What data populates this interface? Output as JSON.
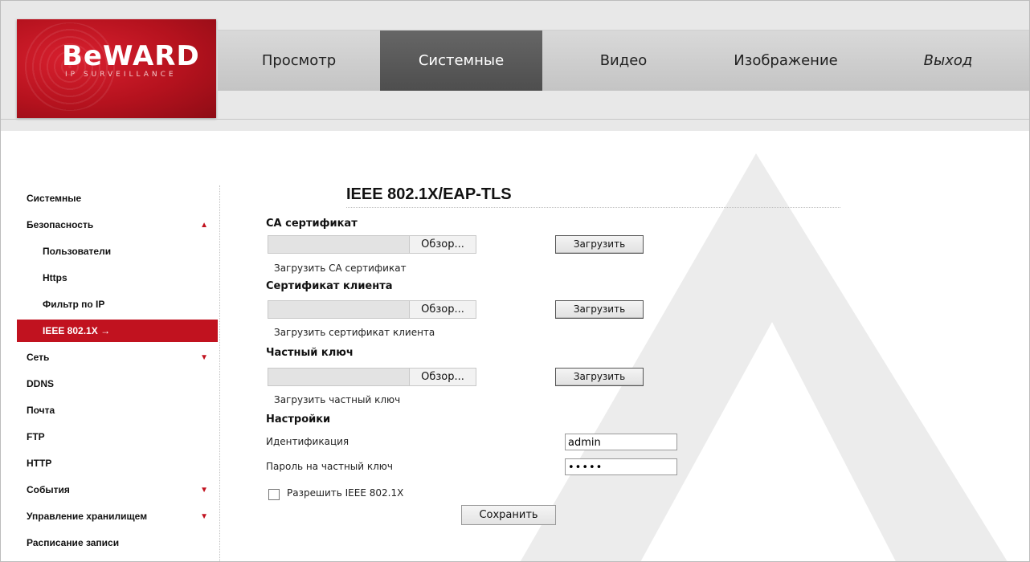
{
  "brand": {
    "name": "BeWARD",
    "tagline": "IP SURVEILLANCE",
    "accent_color": "#c1121f"
  },
  "nav": {
    "items": [
      {
        "label": "Просмотр"
      },
      {
        "label": "Системные"
      },
      {
        "label": "Видео"
      },
      {
        "label": "Изображение"
      },
      {
        "label": "Выход"
      }
    ],
    "active_index": 1
  },
  "sidebar": {
    "items": [
      {
        "label": "Системные"
      },
      {
        "label": "Безопасность",
        "expand_icon": "triangle-up-icon"
      },
      {
        "label": "Пользователи"
      },
      {
        "label": "Https"
      },
      {
        "label": "Фильтр по IP"
      },
      {
        "label": "IEEE 802.1X",
        "indicator": "→"
      },
      {
        "label": "Сеть",
        "expand_icon": "triangle-down-icon"
      },
      {
        "label": "DDNS"
      },
      {
        "label": "Почта"
      },
      {
        "label": "FTP"
      },
      {
        "label": "HTTP"
      },
      {
        "label": "События",
        "expand_icon": "triangle-down-icon"
      },
      {
        "label": "Управление хранилищем",
        "expand_icon": "triangle-down-icon"
      },
      {
        "label": "Расписание записи"
      }
    ],
    "active_index": 5
  },
  "main": {
    "title": "IEEE 802.1X/EAP-TLS",
    "ca": {
      "heading": "CA сертификат",
      "browse_label": "Обзор...",
      "upload_label": "Загрузить",
      "caption": "Загрузить CA сертификат"
    },
    "client": {
      "heading": "Сертификат клиента",
      "browse_label": "Обзор...",
      "upload_label": "Загрузить",
      "caption": "Загрузить сертификат клиента"
    },
    "key": {
      "heading": "Частный ключ",
      "browse_label": "Обзор...",
      "upload_label": "Загрузить",
      "caption": "Загрузить частный ключ"
    },
    "settings": {
      "heading": "Настройки",
      "identity_label": "Идентификация",
      "identity_value": "admin",
      "password_label": "Пароль на частный ключ",
      "password_value": "•••••",
      "enable_label": "Разрешить IEEE 802.1X",
      "enable_checked": false,
      "save_label": "Сохранить"
    }
  }
}
